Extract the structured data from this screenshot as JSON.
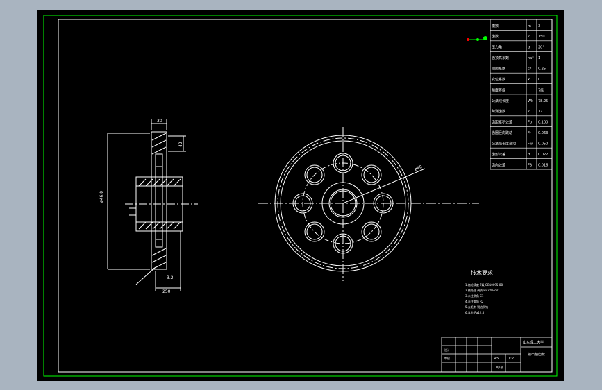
{
  "colors": {
    "workspace": "#a9b4c0",
    "canvas": "#000000",
    "frame": "#00ff00",
    "line": "#ffffff",
    "accent_green": "#00ff00",
    "accent_red": "#ff0000"
  },
  "icons": [
    "ucs-axis-icon"
  ],
  "side_view": {
    "dim_left": "ø46.0",
    "dim_top": "30",
    "dim_right": "42",
    "dim_bottom": "250",
    "roughness_label": "3.2"
  },
  "front_view": {
    "dim_label": "ø40"
  },
  "tech_notes": {
    "title": "技术要求",
    "lines": [
      "1.齿轮精度 7级 GB10095-88",
      "2.热处理 调质 HB220-250",
      "3.未注倒角 C1",
      "4.未注圆角 R2",
      "5.去毛刺 锐边倒钝",
      "6.其余 Ra12.5"
    ]
  },
  "param_table": {
    "rows": [
      [
        "模数",
        "m",
        "3"
      ],
      [
        "齿数",
        "Z",
        "150"
      ],
      [
        "压力角",
        "α",
        "20°"
      ],
      [
        "齿顶高系数",
        "ha*",
        "1"
      ],
      [
        "顶隙系数",
        "c*",
        "0.25"
      ],
      [
        "变位系数",
        "x",
        "0"
      ],
      [
        "精度等级",
        "",
        "7级"
      ],
      [
        "公法线长度",
        "Wk",
        "78.25"
      ],
      [
        "跨测齿数",
        "k",
        "17"
      ],
      [
        "齿距累积公差",
        "Fp",
        "0.100"
      ],
      [
        "齿圈径向跳动",
        "Fr",
        "0.063"
      ],
      [
        "公法线长度变动",
        "Fw",
        "0.050"
      ],
      [
        "齿形公差",
        "ff",
        "0.022"
      ],
      [
        "齿向公差",
        "Fβ",
        "0.016"
      ]
    ]
  },
  "title_block": {
    "school": "山东理工大学",
    "drawing_name": "输出轴齿轮",
    "material": "45",
    "scale": "1:2",
    "sheet": "共1张",
    "designer": "设计",
    "checker": "审核"
  }
}
